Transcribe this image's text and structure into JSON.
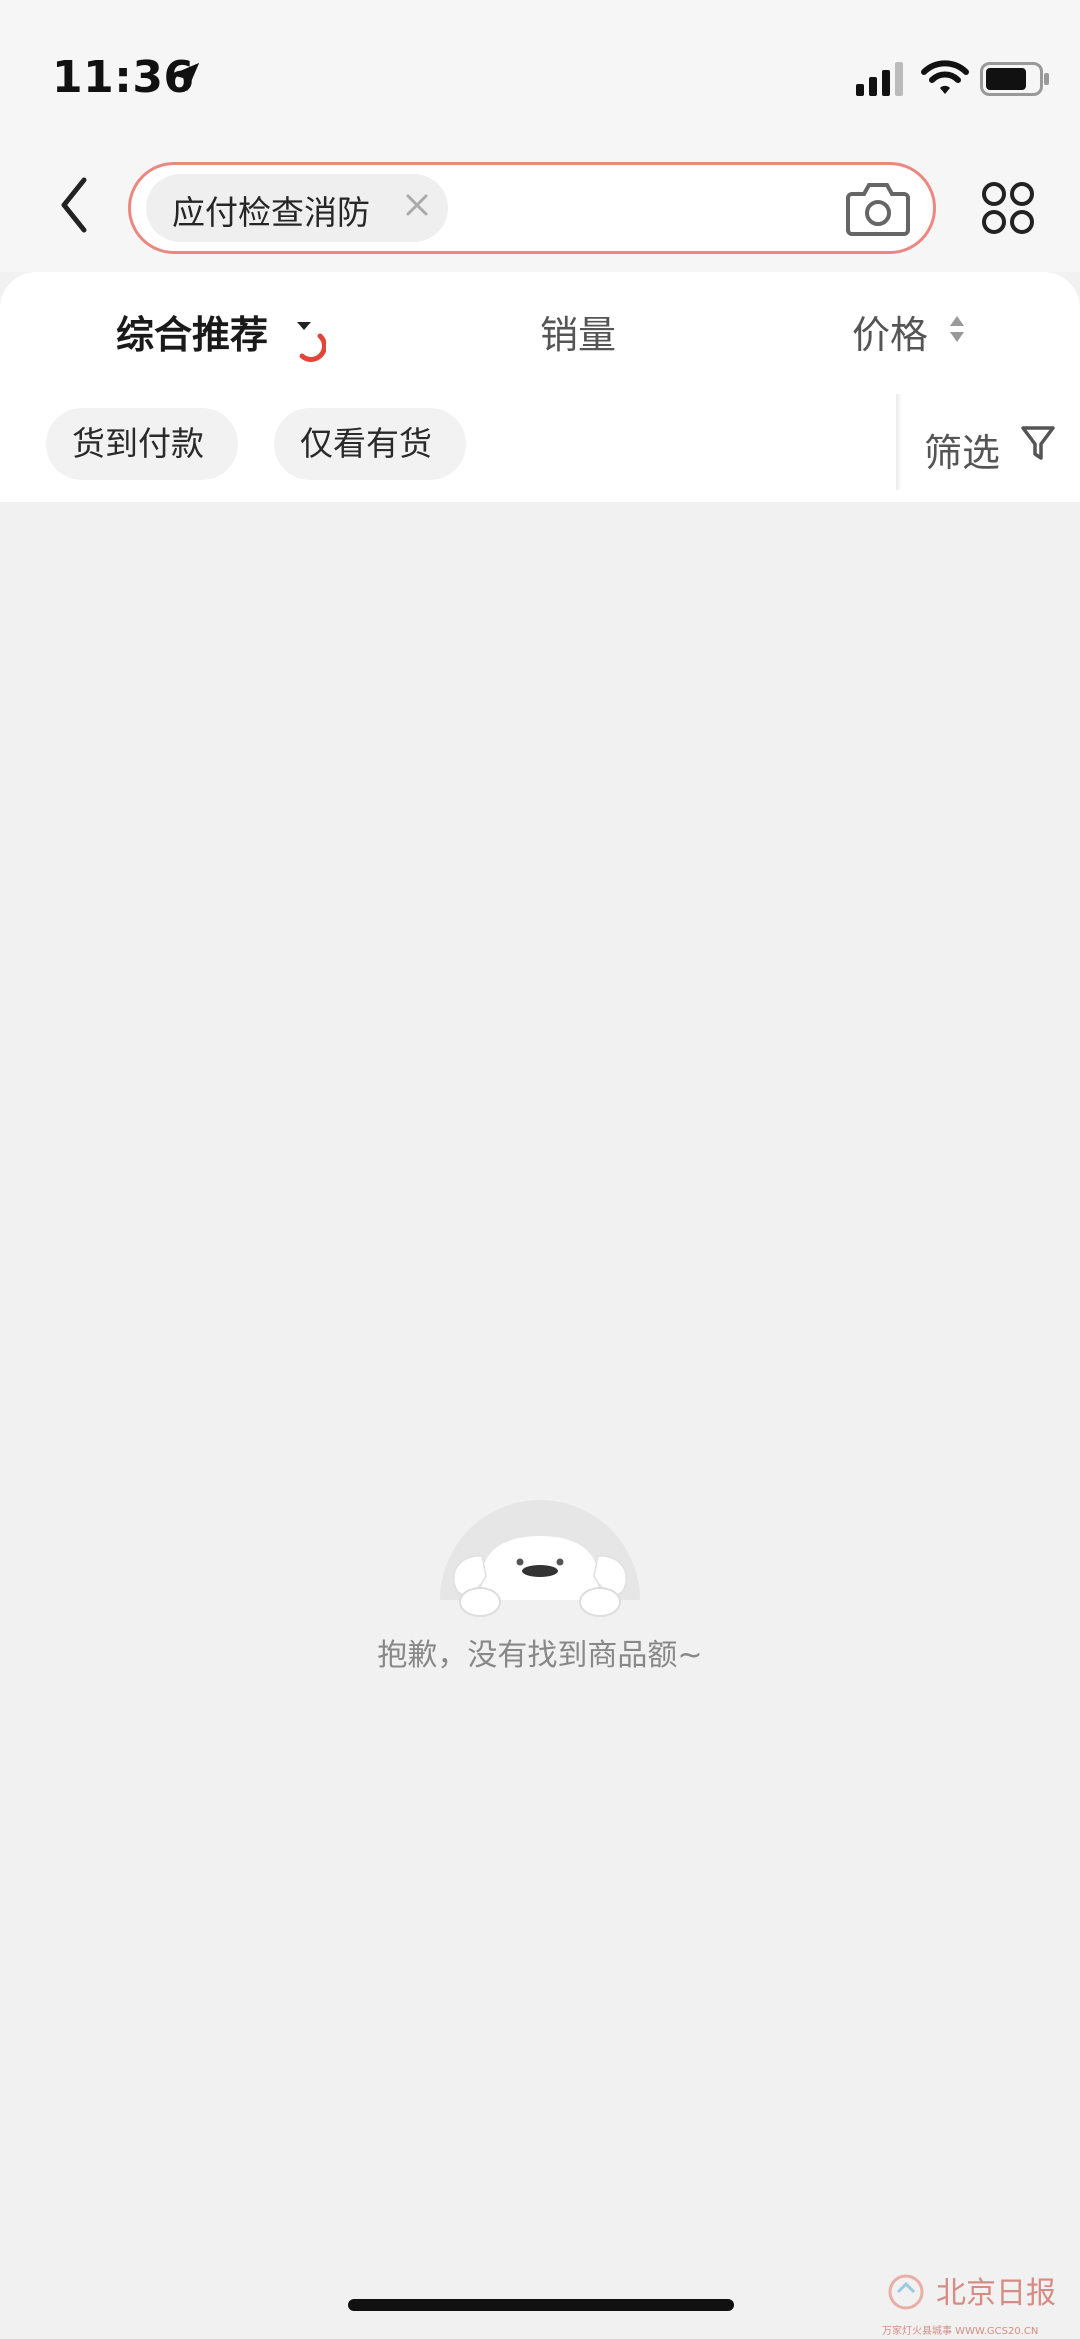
{
  "status_bar": {
    "time": "11:36",
    "icons": [
      "location-arrow-icon",
      "cellular-signal-icon",
      "wifi-icon",
      "battery-icon"
    ]
  },
  "header": {
    "back_icon": "chevron-left-icon",
    "search": {
      "query_tag": "应付检查消防",
      "clear_icon": "close-icon",
      "camera_icon": "camera-icon"
    },
    "menu_icon": "four-circles-grid-icon"
  },
  "sort_bar": {
    "items": [
      {
        "label": "综合推荐",
        "active": true,
        "icon": "caret-down-icon"
      },
      {
        "label": "销量",
        "active": false
      },
      {
        "label": "价格",
        "active": false,
        "icon": "sort-updown-icon"
      }
    ],
    "accent_color": "#e2463a"
  },
  "filters": {
    "chips": [
      "货到付款",
      "仅看有货"
    ],
    "filter_button": {
      "label": "筛选",
      "icon": "funnel-icon"
    }
  },
  "empty_state": {
    "illustration": "dog-peeking-icon",
    "message": "抱歉，没有找到商品额~"
  },
  "watermark": {
    "text": "北京日报",
    "sub": "万家灯火县城事 WWW.GCS20.CN"
  },
  "colors": {
    "search_border": "#ec8780",
    "background": "#f1f1f1"
  }
}
